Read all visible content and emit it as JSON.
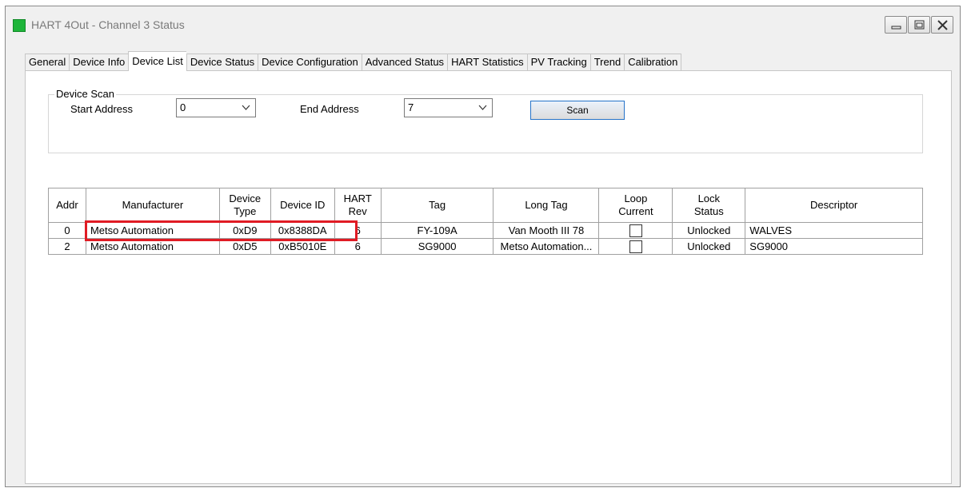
{
  "window": {
    "title": "HART 4Out - Channel 3 Status"
  },
  "tabs": [
    {
      "label": "General",
      "active": false
    },
    {
      "label": "Device Info",
      "active": false
    },
    {
      "label": "Device List",
      "active": true
    },
    {
      "label": "Device Status",
      "active": false
    },
    {
      "label": "Device Configuration",
      "active": false
    },
    {
      "label": "Advanced Status",
      "active": false
    },
    {
      "label": "HART Statistics",
      "active": false
    },
    {
      "label": "PV Tracking",
      "active": false
    },
    {
      "label": "Trend",
      "active": false
    },
    {
      "label": "Calibration",
      "active": false
    }
  ],
  "device_scan": {
    "group_title": "Device Scan",
    "start_label": "Start Address",
    "start_value": "0",
    "end_label": "End Address",
    "end_value": "7",
    "scan_label": "Scan"
  },
  "table": {
    "headers": {
      "addr": "Addr",
      "manufacturer": "Manufacturer",
      "device_type": [
        "Device",
        "Type"
      ],
      "device_id": "Device ID",
      "hart_rev": [
        "HART",
        "Rev"
      ],
      "tag": "Tag",
      "long_tag": "Long Tag",
      "loop_current": [
        "Loop",
        "Current"
      ],
      "lock_status": [
        "Lock",
        "Status"
      ],
      "descriptor": "Descriptor"
    },
    "rows": [
      {
        "addr": "0",
        "manufacturer": "Metso Automation",
        "device_type": "0xD9",
        "device_id": "0x8388DA",
        "hart_rev": "6",
        "tag": "FY-109A",
        "long_tag": "Van Mooth III 78",
        "lock_status": "Unlocked",
        "descriptor": "WALVES"
      },
      {
        "addr": "2",
        "manufacturer": "Metso Automation",
        "device_type": "0xD5",
        "device_id": "0xB5010E",
        "hart_rev": "6",
        "tag": "SG9000",
        "long_tag": "Metso Automation...",
        "lock_status": "Unlocked",
        "descriptor": "SG9000"
      }
    ]
  },
  "highlight_color": "#e01b24",
  "accent_color": "#2673c9",
  "icons": {
    "app": "status-square-icon",
    "minimize": "minimize-icon",
    "maximize": "maximize-icon",
    "close": "close-icon",
    "dropdown": "chevron-down-icon"
  }
}
